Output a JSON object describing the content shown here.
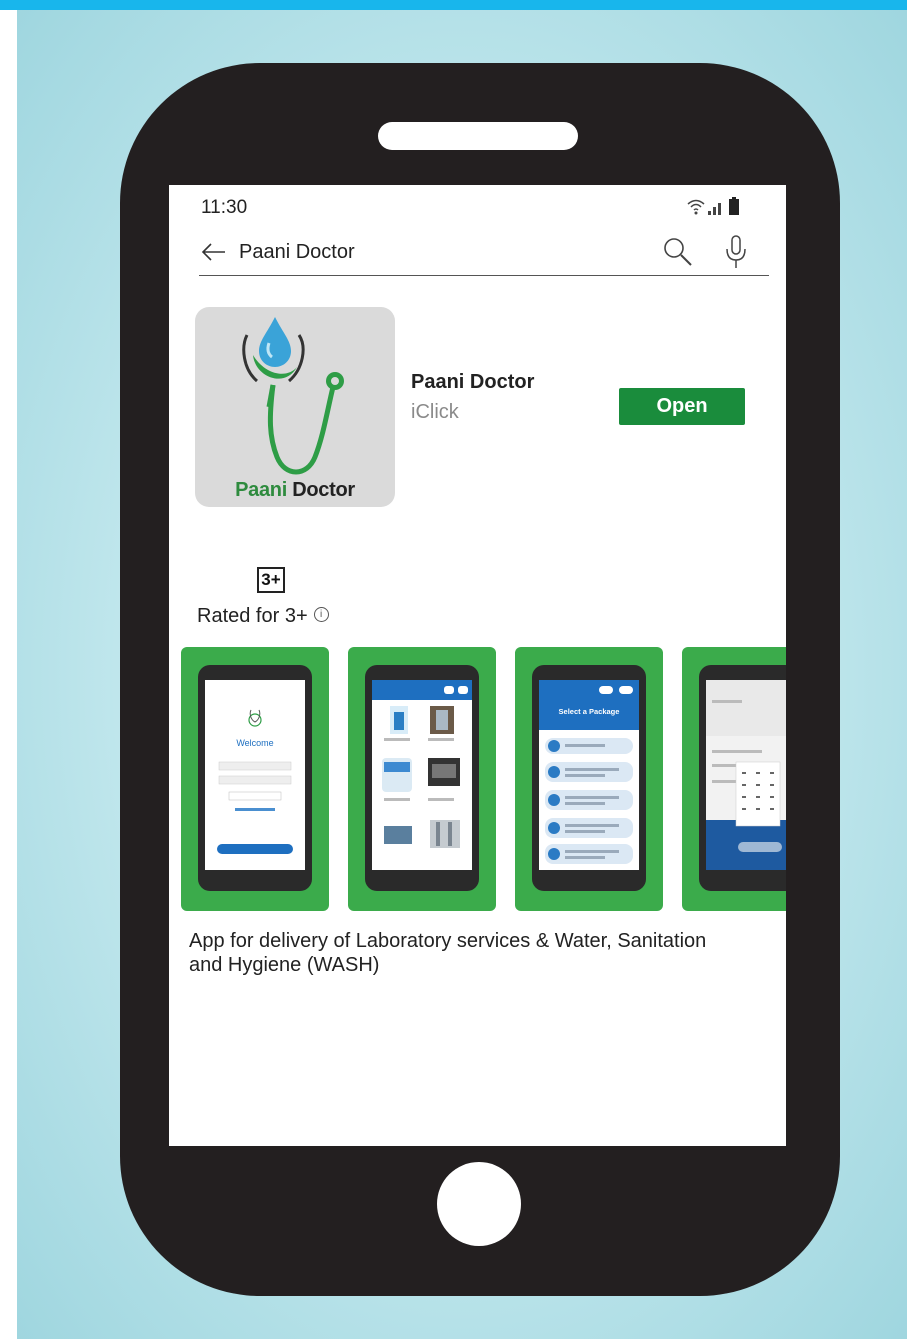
{
  "status_bar": {
    "time": "11:30"
  },
  "search": {
    "query": "Paani Doctor"
  },
  "app": {
    "name": "Paani Doctor",
    "developer": "iClick",
    "open_label": "Open",
    "logo_word_1": "Paani",
    "logo_word_2": "Doctor"
  },
  "rating": {
    "badge": "3+",
    "label": "Rated for 3+"
  },
  "screenshots": {
    "shot1": {
      "title": "Welcome"
    },
    "shot3": {
      "title": "Select a Package"
    }
  },
  "description": "App for delivery of Laboratory services & Water, Sanitation and Hygiene (WASH)",
  "colors": {
    "accent_green": "#1a8c3c",
    "screenshot_green": "#3bab4b",
    "phone_body": "#231f20",
    "app_blue": "#1e6fc0",
    "top_bar": "#18b6ec"
  }
}
